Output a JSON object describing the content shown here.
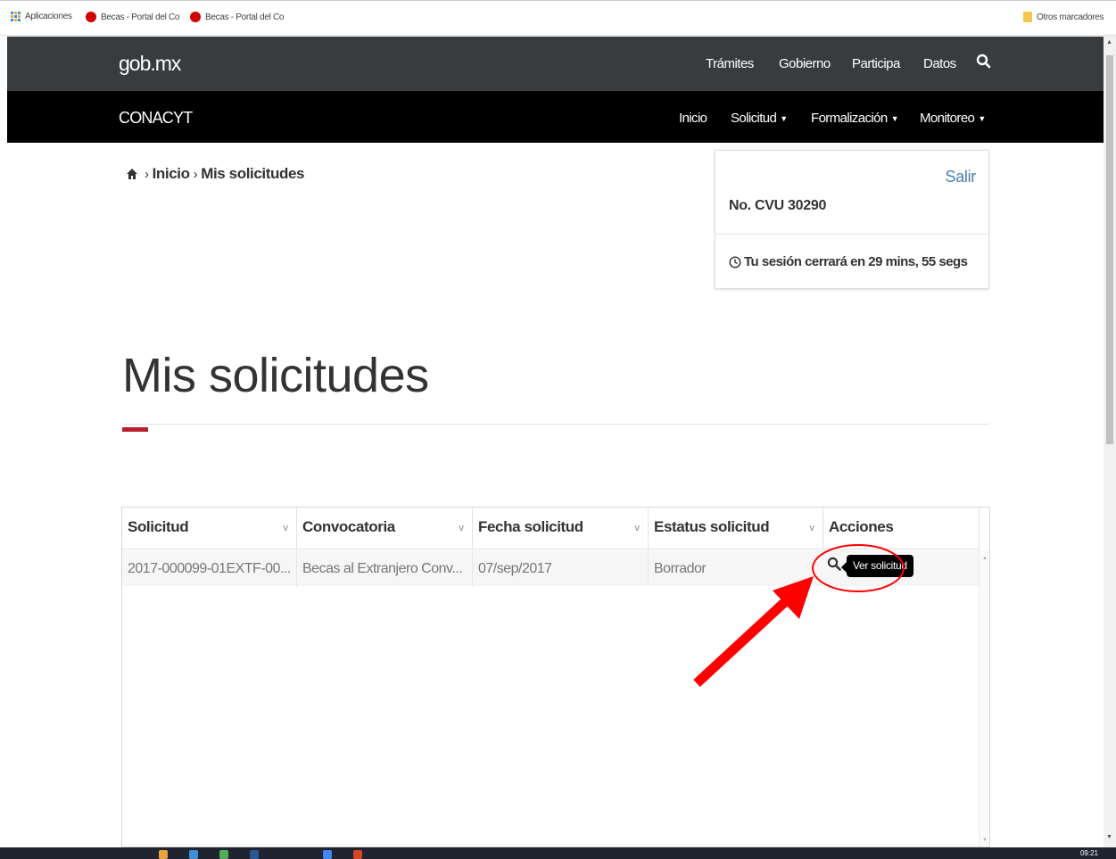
{
  "bookmarks": {
    "apps_label": "Aplicaciones",
    "items": [
      "Becas - Portal del Co",
      "Becas - Portal del Co"
    ],
    "other_label": "Otros marcadores"
  },
  "gob": {
    "logo": "gob.mx",
    "nav": [
      "Trámites",
      "Gobierno",
      "Participa",
      "Datos"
    ]
  },
  "conacyt": {
    "title": "CONACYT",
    "nav": [
      "Inicio",
      "Solicitud",
      "Formalización",
      "Monitoreo"
    ]
  },
  "breadcrumb": {
    "items": [
      "Inicio",
      "Mis solicitudes"
    ]
  },
  "session": {
    "logout": "Salir",
    "cvu": "No. CVU 30290",
    "timer": "Tu sesión cerrará en 29 mins, 55 segs"
  },
  "page": {
    "title": "Mis solicitudes"
  },
  "table": {
    "columns": [
      "Solicitud",
      "Convocatoria",
      "Fecha solicitud",
      "Estatus solicitud",
      "Acciones"
    ],
    "rows": [
      {
        "solicitud": "2017-000099-01EXTF-00...",
        "convocatoria": "Becas al Extranjero Conv...",
        "fecha": "07/sep/2017",
        "estatus": "Borrador"
      }
    ],
    "tooltip": "Ver solicitud"
  },
  "taskbar": {
    "clock": "09:21"
  },
  "colors": {
    "gob_bar": "#393c3e",
    "conacyt_bar": "#000000",
    "accent": "#b7202e",
    "link": "#4a7fb5",
    "annotation": "#ff0000"
  }
}
